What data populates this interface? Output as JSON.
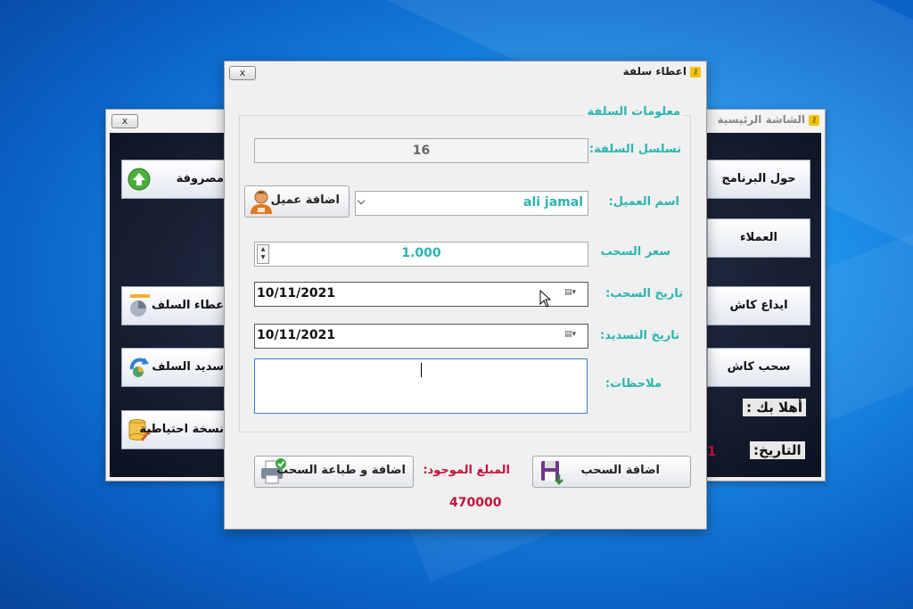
{
  "main_window": {
    "title": "الشاشة الرئيسية",
    "close_label": "x",
    "right_buttons": [
      "حول البرنامج",
      "العملاء",
      "ايداع كاش",
      "سحب كاش"
    ],
    "left_buttons": [
      "مصروفة",
      "عطاء السلف",
      "سديد السلف",
      "نسخة احتياطية"
    ],
    "welcome_label": "أهلا بك :",
    "date_label": "التاريخ:",
    "date_value_partial": "1"
  },
  "dialog": {
    "title": "اعطاء سلفة",
    "close_label": "x",
    "group_title": "معلومات السلفة",
    "labels": {
      "serial": "تسلسل السلفة:",
      "client": "اسم العميل:",
      "rate": "سعر السحب",
      "withdraw_date": "تاريخ السحب:",
      "repay_date": "تاريخ التسديد:",
      "notes": "ملاحظات:"
    },
    "values": {
      "serial": "16",
      "client": "ali jamal",
      "rate": "1.000",
      "withdraw_date": "10/11/2021",
      "repay_date": "10/11/2021",
      "notes": ""
    },
    "add_client_button": "اضافة عميل",
    "add_withdraw_button": "اضافة السحب",
    "add_print_button": "اضافة و طباعة السحب",
    "balance_label": "المبلغ الموجود:",
    "balance_value": "470000"
  },
  "colors": {
    "accent_teal": "#2bb5b0",
    "balance_red": "#c0143c"
  }
}
